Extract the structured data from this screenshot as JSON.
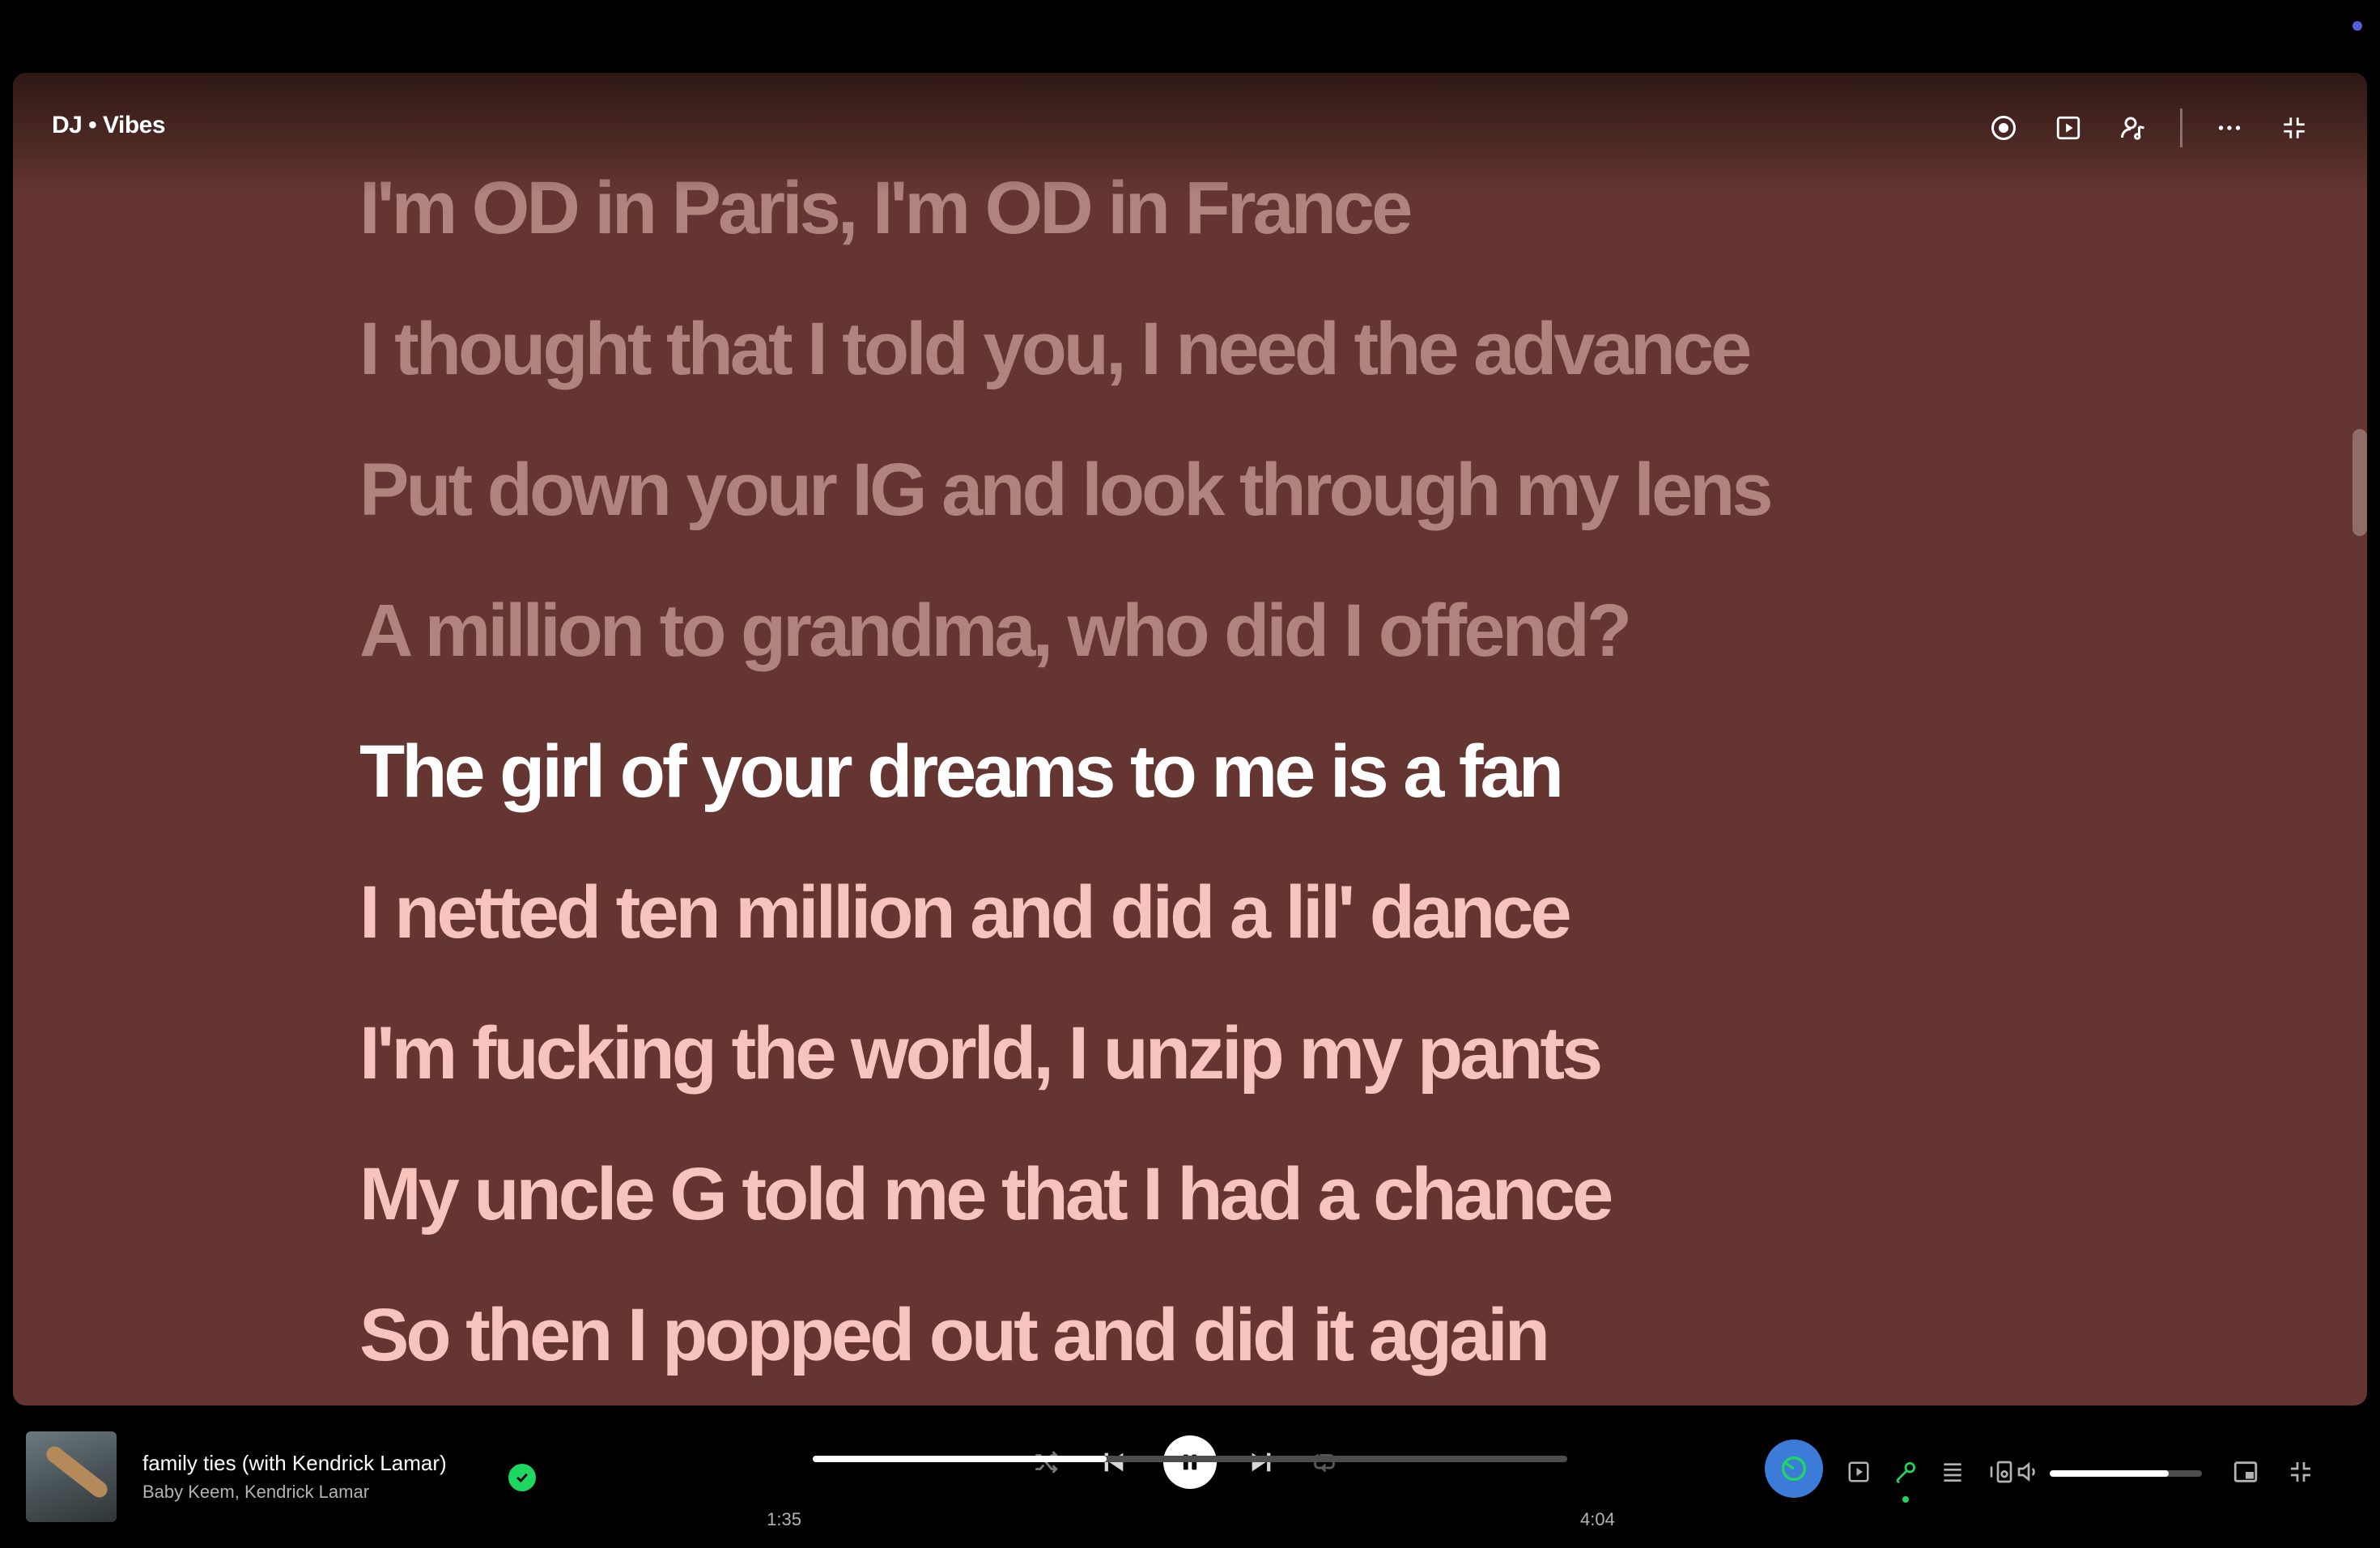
{
  "header": {
    "context_title": "DJ • Vibes",
    "actions": [
      {
        "name": "now-playing-view-icon"
      },
      {
        "name": "video-icon"
      },
      {
        "name": "artist-icon"
      },
      {
        "name": "more-options-icon"
      },
      {
        "name": "exit-fullscreen-icon"
      }
    ]
  },
  "lyrics": {
    "ghost_line": "",
    "past_lines": [
      "I'm OD in Paris, I'm OD in France",
      "I thought that I told you, I need the advance",
      "Put down your IG and look through my lens",
      "A million to grandma, who did I offend?"
    ],
    "active_line": "The girl of your dreams to me is a fan",
    "upcoming_lines": [
      "I netted ten million and did a lil' dance",
      "I'm fucking the world, I unzip my pants",
      "My uncle G told me that I had a chance",
      "So then I popped out and did it again"
    ]
  },
  "now_playing": {
    "title": "family ties (with Kendrick Lamar)",
    "artists": "Baby Keem, Kendrick Lamar",
    "saved": true
  },
  "playback": {
    "elapsed": "1:35",
    "total": "4:04",
    "progress_fraction": 0.39,
    "shuffle": false,
    "repeat": false,
    "playing": true
  },
  "volume": {
    "level_fraction": 0.78
  },
  "colors": {
    "lyrics_background": "#653631",
    "active_lyric": "#ffffff",
    "upcoming_lyric": "#f6c4bd",
    "past_lyric": "#b0837d",
    "accent_green": "#1ed760",
    "dj_blue": "#3d7bd9"
  }
}
